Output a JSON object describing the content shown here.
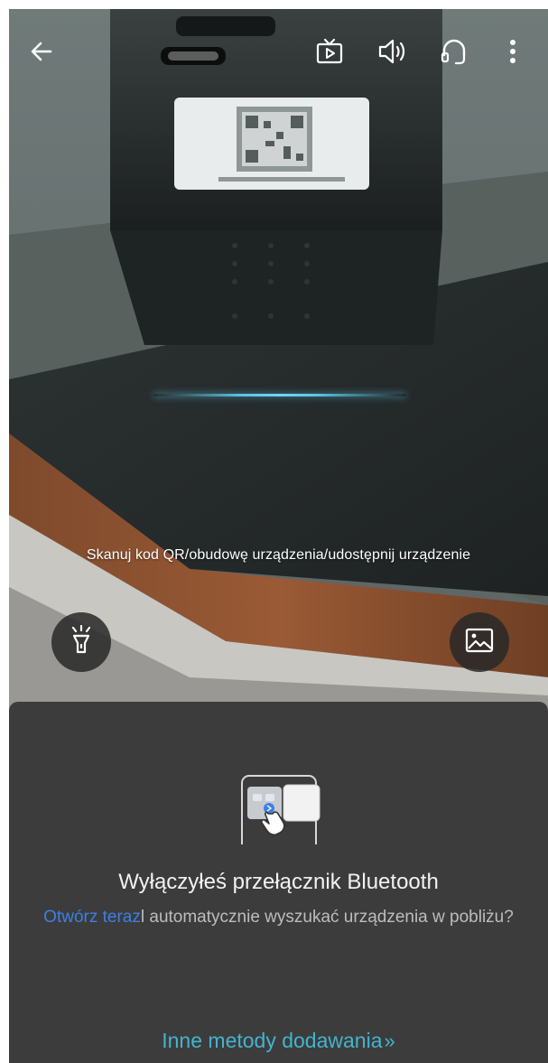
{
  "top_bar": {
    "back_icon": "arrow-left-icon",
    "actions": [
      {
        "name": "tv-play-icon"
      },
      {
        "name": "speaker-icon"
      },
      {
        "name": "headset-icon"
      },
      {
        "name": "more-vertical-icon"
      }
    ]
  },
  "scanner": {
    "hint": "Skanuj kod QR/obudowę urządzenia/udostępnij urządzenie",
    "flash_icon": "flashlight-icon",
    "gallery_icon": "image-gallery-icon"
  },
  "bluetooth_sheet": {
    "title": "Wyłączyłeś przełącznik Bluetooth",
    "open_link": "Otwórz teraz",
    "description": "l automatycznie wyszukać urządzenia w pobliżu?",
    "other_methods": "Inne metody dodawania",
    "other_methods_chevron": "»",
    "link_color": "#3d7fe6",
    "accent_color": "#43b4cf"
  }
}
